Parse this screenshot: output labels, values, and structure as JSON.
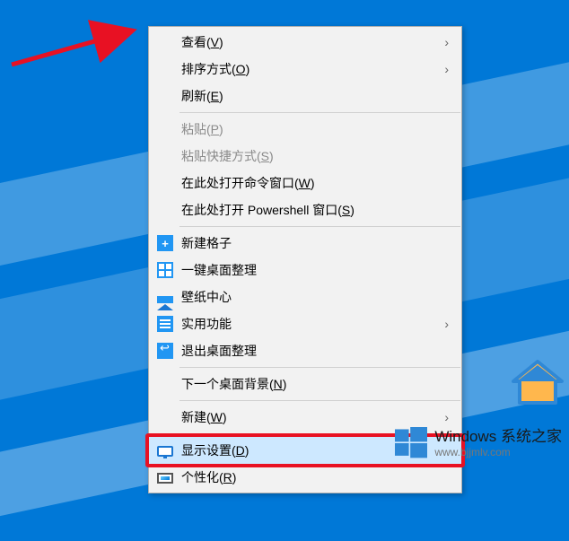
{
  "menu": {
    "view": {
      "text": "查看(",
      "key": "V",
      "suffix": ")"
    },
    "sort": {
      "text": "排序方式(",
      "key": "O",
      "suffix": ")"
    },
    "refresh": {
      "text": "刷新(",
      "key": "E",
      "suffix": ")"
    },
    "paste": {
      "text": "粘贴(",
      "key": "P",
      "suffix": ")"
    },
    "paste_shortcut": {
      "text": "粘贴快捷方式(",
      "key": "S",
      "suffix": ")"
    },
    "open_cmd": {
      "text": "在此处打开命令窗口(",
      "key": "W",
      "suffix": ")"
    },
    "open_powershell": {
      "text": "在此处打开 Powershell 窗口(",
      "key": "S",
      "suffix": ")"
    },
    "new_grid": {
      "text": "新建格子"
    },
    "one_click_arrange": {
      "text": "一键桌面整理"
    },
    "wallpaper_center": {
      "text": "壁纸中心"
    },
    "practical_functions": {
      "text": "实用功能"
    },
    "exit_desktop_arrange": {
      "text": "退出桌面整理"
    },
    "next_wallpaper": {
      "text": "下一个桌面背景(",
      "key": "N",
      "suffix": ")"
    },
    "new": {
      "text": "新建(",
      "key": "W",
      "suffix": ")"
    },
    "display_settings": {
      "text": "显示设置(",
      "key": "D",
      "suffix": ")"
    },
    "personalize": {
      "text": "个性化(",
      "key": "R",
      "suffix": ")"
    }
  },
  "watermark": {
    "title": "Windows 系统之家",
    "url": "www.bjjmlv.com"
  }
}
